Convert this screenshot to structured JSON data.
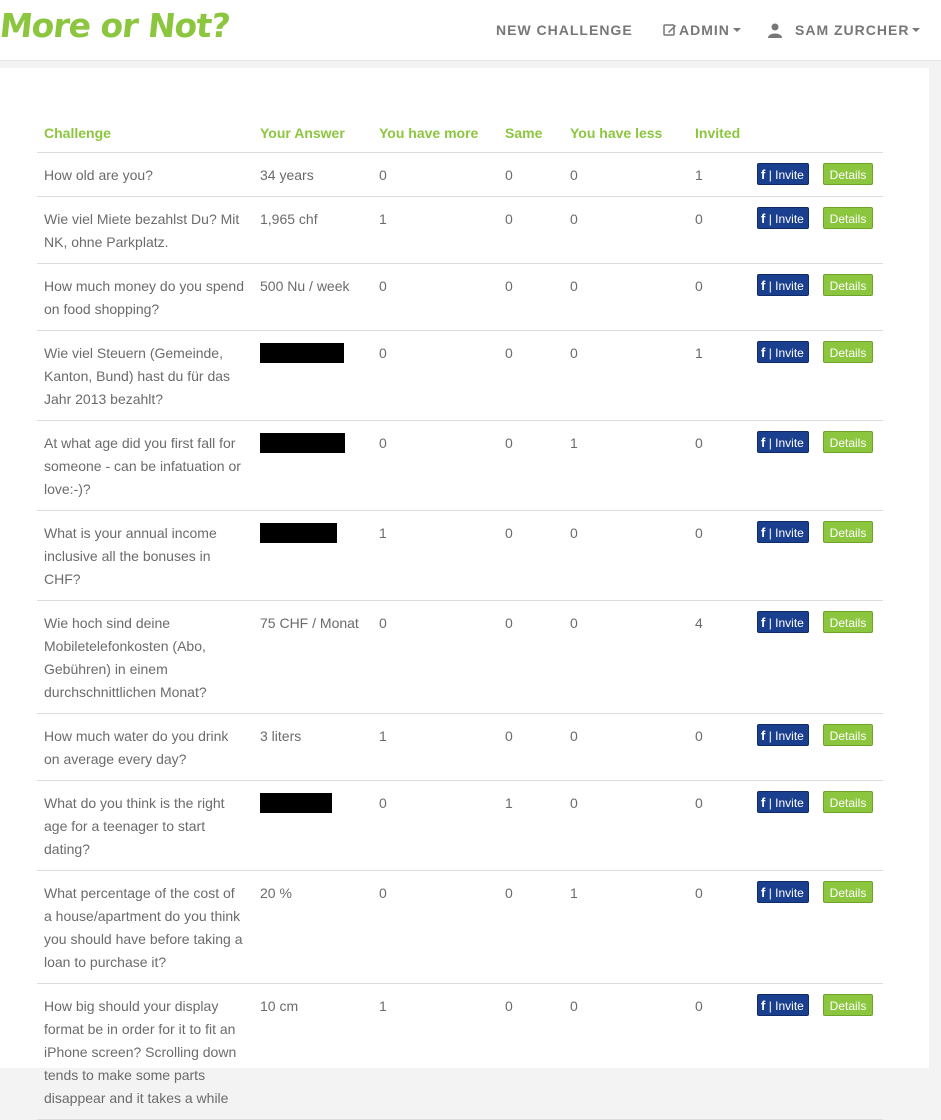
{
  "nav": {
    "brand": "More or Not?",
    "new_challenge": "NEW CHALLENGE",
    "admin": "ADMIN",
    "user": "SAM ZURCHER"
  },
  "table": {
    "headers": [
      "Challenge",
      "Your Answer",
      "You have more",
      "Same",
      "You have less",
      "Invited",
      ""
    ],
    "fb_label": "f",
    "invite_label": "| Invite",
    "details_label": "Details",
    "rows": [
      {
        "challenge": "How old are you?",
        "answer": "34 years",
        "more": "0",
        "same": "0",
        "less": "0",
        "invited": "1"
      },
      {
        "challenge": "Wie viel Miete bezahlst Du? Mit NK, ohne Parkplatz.",
        "answer": "1,965 chf",
        "more": "1",
        "same": "0",
        "less": "0",
        "invited": "0"
      },
      {
        "challenge": "How much money do you spend on food shopping?",
        "answer": "500 Nu / week",
        "more": "0",
        "same": "0",
        "less": "0",
        "invited": "0"
      },
      {
        "challenge": "Wie viel Steuern (Gemeinde, Kanton, Bund) hast du für das Jahr 2013 bezahlt?",
        "answer": "",
        "more": "0",
        "same": "0",
        "less": "0",
        "invited": "1"
      },
      {
        "challenge": "At what age did you first fall for someone - can be infatuation or love:-)?",
        "answer": "",
        "more": "0",
        "same": "0",
        "less": "1",
        "invited": "0"
      },
      {
        "challenge": "What is your annual income inclusive all the bonuses in CHF?",
        "answer": "",
        "more": "1",
        "same": "0",
        "less": "0",
        "invited": "0"
      },
      {
        "challenge": "Wie hoch sind deine Mobiletelefonkosten (Abo, Gebühren) in einem durchschnittlichen Monat?",
        "answer": "75 CHF / Monat",
        "more": "0",
        "same": "0",
        "less": "0",
        "invited": "4"
      },
      {
        "challenge": "How much water do you drink on average every day?",
        "answer": "3 liters",
        "more": "1",
        "same": "0",
        "less": "0",
        "invited": "0"
      },
      {
        "challenge": "What do you think is the right age for a teenager to start dating?",
        "answer": "",
        "more": "0",
        "same": "1",
        "less": "0",
        "invited": "0"
      },
      {
        "challenge": "What percentage of the cost of a house/apartment do you think you should have before taking a loan to purchase it?",
        "answer": "20 %",
        "more": "0",
        "same": "0",
        "less": "1",
        "invited": "0"
      },
      {
        "challenge": "How big should your display format be in order for it to fit an iPhone screen? Scrolling down tends to make some parts disappear and it takes a while",
        "answer": "10 cm",
        "more": "1",
        "same": "0",
        "less": "0",
        "invited": "0"
      }
    ]
  }
}
